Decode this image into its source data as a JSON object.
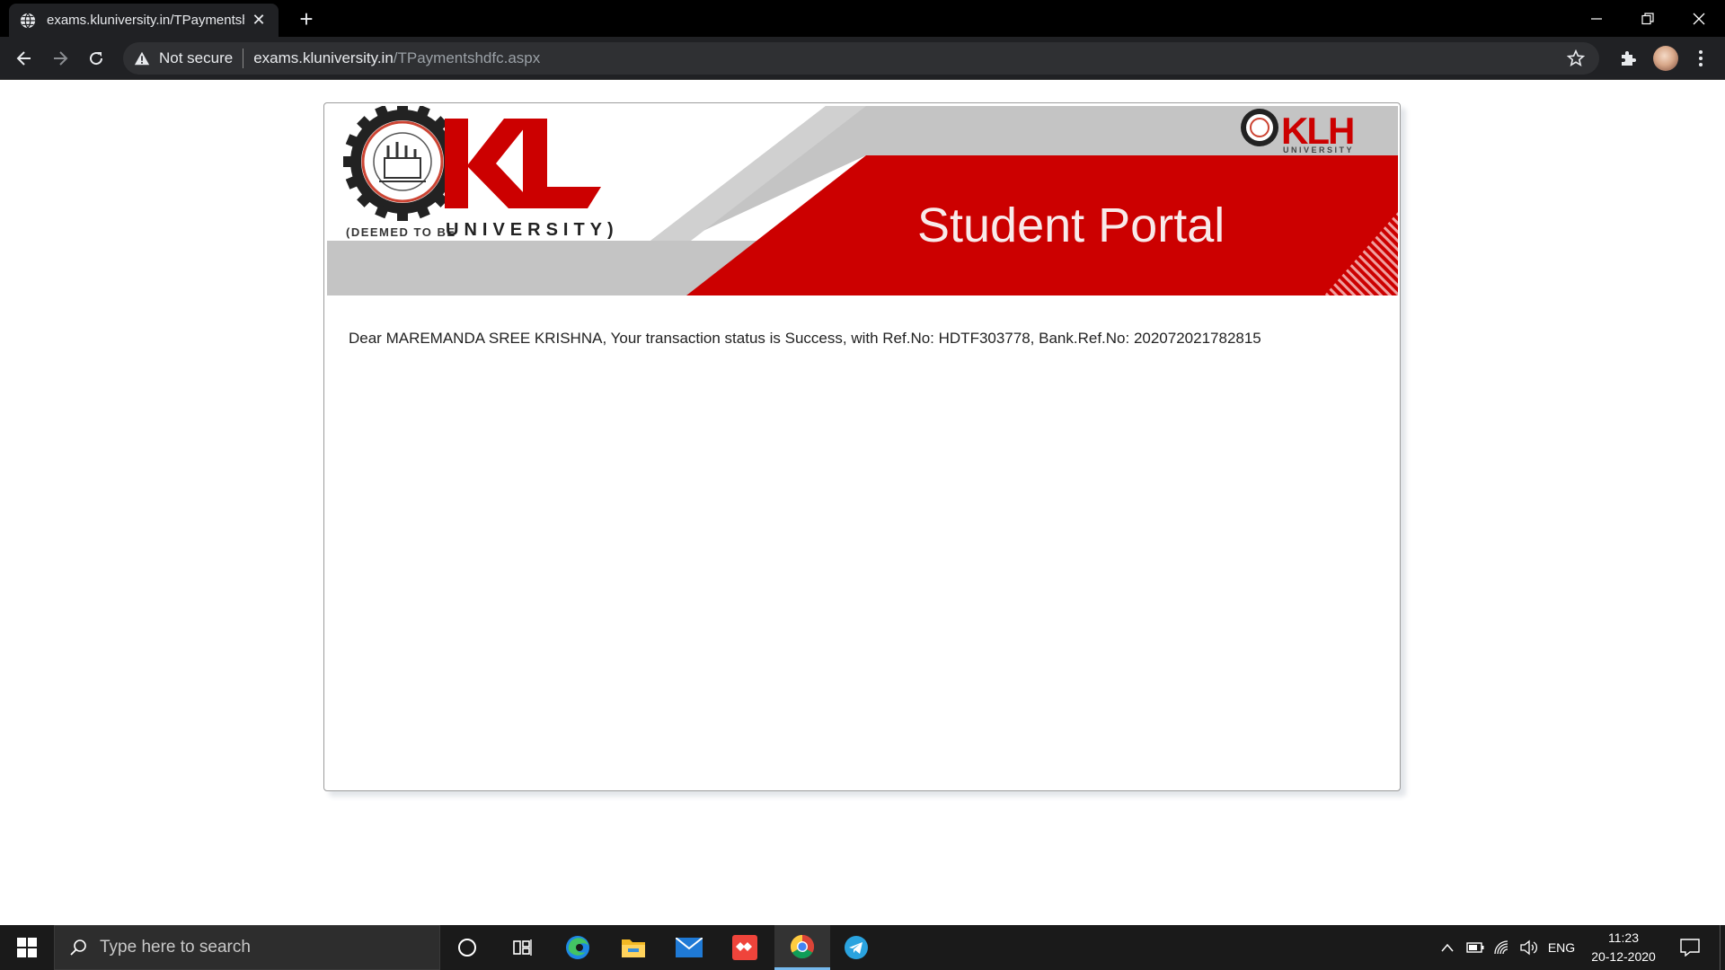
{
  "browser": {
    "tab_title": "exams.kluniversity.in/TPaymentshdfc.aspx",
    "new_tab_symbol": "+",
    "close_symbol": "✕",
    "security_label": "Not secure",
    "url_host": "exams.kluniversity.in",
    "url_path": "/TPaymentshdfc.aspx",
    "icons": [
      "globe-icon",
      "back-icon",
      "forward-icon",
      "reload-icon",
      "warning-icon",
      "star-icon",
      "extensions-icon",
      "menu-icon"
    ]
  },
  "banner": {
    "logo_kl": "KL",
    "deemed_text": "(DEEMED TO BE",
    "university_text": "UNIVERSITY)",
    "title": "Student Portal",
    "small_logo": "KLH",
    "small_logo_sub": "UNIVERSITY",
    "colors": {
      "red": "#cc0000",
      "grey": "#c4c4c4"
    }
  },
  "message": "Dear MAREMANDA SREE KRISHNA, Your transaction status is Success, with Ref.No: HDTF303778, Bank.Ref.No: 202072021782815",
  "taskbar": {
    "search_placeholder": "Type here to search",
    "language": "ENG",
    "time": "11:23",
    "date": "20-12-2020",
    "apps": [
      "cortana-icon",
      "task-view-icon",
      "edge-icon",
      "file-explorer-icon",
      "mail-icon",
      "anydesk-icon",
      "chrome-icon",
      "telegram-icon"
    ]
  }
}
